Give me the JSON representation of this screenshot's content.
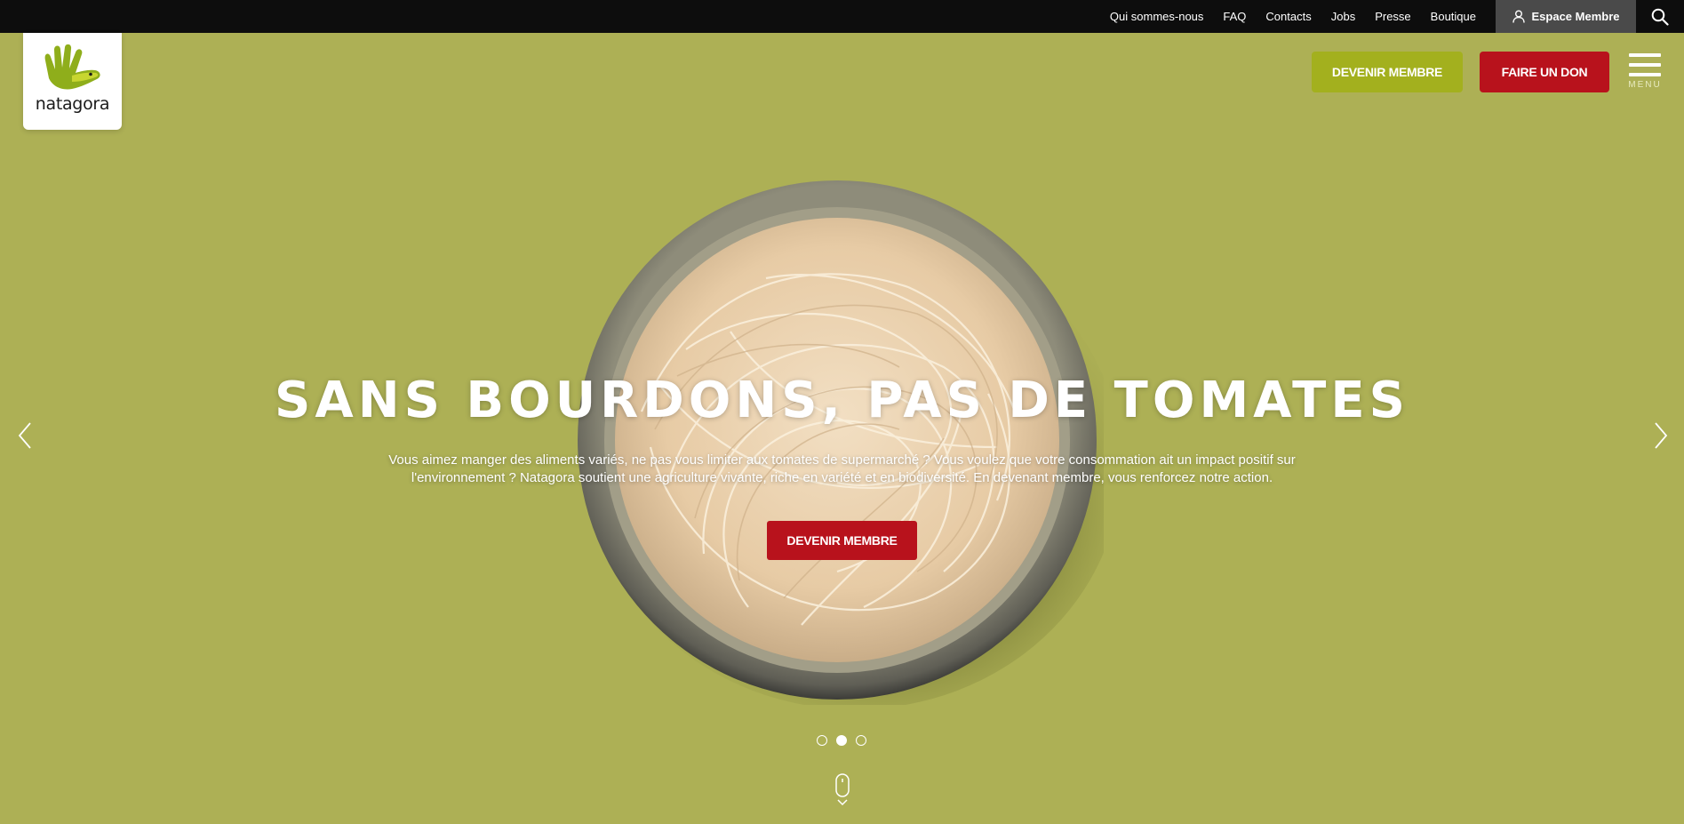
{
  "topbar": {
    "links": [
      "Qui sommes-nous",
      "FAQ",
      "Contacts",
      "Jobs",
      "Presse",
      "Boutique"
    ],
    "member_space": "Espace Membre",
    "member_icon": "user-icon",
    "search_icon": "search-icon"
  },
  "logo": {
    "text": "natagora",
    "icon": "hand-logo-icon"
  },
  "header": {
    "member_button": "DEVENIR MEMBRE",
    "donate_button": "FAIRE UN DON",
    "menu_label": "MENU"
  },
  "slide": {
    "title": "SANS BOURDONS, PAS DE TOMATES",
    "text_line1": "Vous aimez manger des aliments variés, ne pas vous limiter aux tomates de supermarché ? Vous voulez que votre consommation ait un impact positif sur",
    "text_line2": "l'environnement ? Natagora soutient une agriculture vivante, riche en variété et en biodiversité. En devenant membre, vous renforcez notre action.",
    "cta": "DEVENIR MEMBRE"
  },
  "carousel": {
    "slides": 3,
    "active": 2
  },
  "colors": {
    "background": "#adb055",
    "accent_green": "#a3b01e",
    "accent_red": "#b8121c",
    "topbar": "#0d0d0d"
  }
}
